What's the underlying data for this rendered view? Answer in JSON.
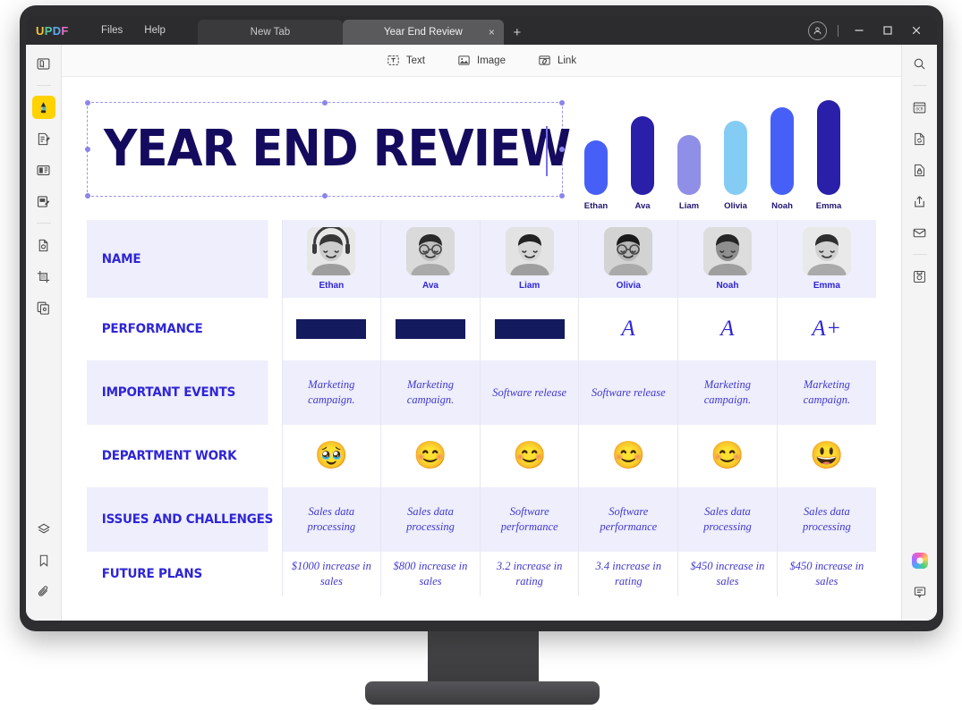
{
  "app": {
    "brand": "UPDF",
    "brand_letters": [
      {
        "ch": "U",
        "color": "#f2c33c"
      },
      {
        "ch": "P",
        "color": "#52c9a6"
      },
      {
        "ch": "D",
        "color": "#5aa9f0"
      },
      {
        "ch": "F",
        "color": "#e46fc9"
      }
    ],
    "menus": [
      "Files",
      "Help"
    ],
    "tabs": [
      {
        "label": "New Tab",
        "active": false,
        "closable": false
      },
      {
        "label": "Year End Review",
        "active": true,
        "closable": true
      }
    ],
    "new_tab_glyph": "+",
    "close_glyph": "×",
    "window_controls": {
      "account": "account-icon",
      "minimize": "—",
      "maximize": "□",
      "close": "✕"
    }
  },
  "toolbar": {
    "items": [
      {
        "label": "Text",
        "icon": "text-box-icon"
      },
      {
        "label": "Image",
        "icon": "image-icon"
      },
      {
        "label": "Link",
        "icon": "link-icon"
      }
    ]
  },
  "left_rail": {
    "items": [
      {
        "icon": "reader-view-icon",
        "active": false
      },
      {
        "icon": "edit-pdf-icon",
        "active": true
      },
      {
        "icon": "edit-text-icon",
        "active": false
      },
      {
        "icon": "page-layout-icon",
        "active": false
      },
      {
        "icon": "annotate-icon",
        "active": false
      },
      {
        "icon": "ocr-document-icon",
        "active": false
      },
      {
        "icon": "crop-page-icon",
        "active": false
      },
      {
        "icon": "organize-pages-icon",
        "active": false
      }
    ],
    "bottom_items": [
      {
        "icon": "layers-icon"
      },
      {
        "icon": "bookmark-icon"
      },
      {
        "icon": "attachment-icon"
      }
    ]
  },
  "right_rail": {
    "items": [
      {
        "icon": "search-icon"
      },
      {
        "icon": "ocr-icon"
      },
      {
        "icon": "convert-icon"
      },
      {
        "icon": "protect-icon"
      },
      {
        "icon": "share-icon"
      },
      {
        "icon": "email-icon"
      },
      {
        "icon": "save-icon"
      }
    ],
    "bottom_items": [
      {
        "icon": "ai-assistant-icon"
      },
      {
        "icon": "comment-icon"
      }
    ]
  },
  "document": {
    "title": "YEAR END REVIEW",
    "title_selected": true
  },
  "chart_data": {
    "type": "bar",
    "title": "",
    "categories": [
      "Ethan",
      "Ava",
      "Liam",
      "Olivia",
      "Noah",
      "Emma"
    ],
    "values": [
      62,
      90,
      68,
      85,
      100,
      108
    ],
    "colors": [
      "#4660f7",
      "#2a1fa8",
      "#8f8fe8",
      "#85ccf5",
      "#4660f7",
      "#2a1fa8"
    ],
    "xlabel": "",
    "ylabel": "",
    "ylim": [
      0,
      110
    ],
    "grid": false,
    "legend": "none"
  },
  "table": {
    "columns": [
      "Ethan",
      "Ava",
      "Liam",
      "Olivia",
      "Noah",
      "Emma"
    ],
    "rows": [
      {
        "label": "NAME",
        "type": "person",
        "cells": [
          "Ethan",
          "Ava",
          "Liam",
          "Olivia",
          "Noah",
          "Emma"
        ]
      },
      {
        "label": "PERFORMANCE",
        "type": "grade",
        "cells": [
          "redacted",
          "redacted",
          "redacted",
          "A",
          "A",
          "A+"
        ]
      },
      {
        "label": "IMPORTANT EVENTS",
        "type": "text",
        "cells": [
          "Marketing\ncampaign.",
          "Marketing\ncampaign.",
          "Software release",
          "Software release",
          "Marketing\ncampaign.",
          "Marketing\ncampaign."
        ]
      },
      {
        "label": "DEPARTMENT WORK",
        "type": "emoji",
        "cells": [
          "🥹",
          "😊",
          "😊",
          "😊",
          "😊",
          "😃"
        ]
      },
      {
        "label": "ISSUES AND CHALLENGES",
        "type": "text",
        "cells": [
          "Sales data\nprocessing",
          "Sales data\nprocessing",
          "Software\nperformance",
          "Software\nperformance",
          "Sales data\nprocessing",
          "Sales data\nprocessing"
        ]
      },
      {
        "label": "FUTURE PLANS",
        "type": "text",
        "cells": [
          "$1000 increase in\nsales",
          "$800 increase in\nsales",
          "3.2 increase in\nrating",
          "3.4 increase in\nrating",
          "$450 increase in\nsales",
          "$450 increase in\nsales"
        ]
      }
    ]
  },
  "colors": {
    "accent": "#2e25d6",
    "title_navy": "#150b5e",
    "row_shade": "#eeeefc",
    "selection": "#8b84ec",
    "active_tool": "#ffd200"
  }
}
